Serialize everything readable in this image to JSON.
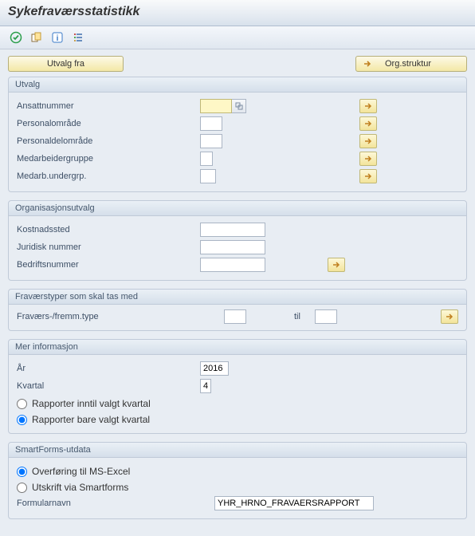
{
  "title": "Sykefraværsstatistikk",
  "icons": {
    "execute": "execute-icon",
    "variants": "variants-icon",
    "info": "info-icon",
    "list": "list-icon",
    "arrow": "arrow-icon"
  },
  "buttons": {
    "utvalg_fra": "Utvalg fra",
    "org_struktur": "Org.struktur"
  },
  "groups": {
    "utvalg": {
      "title": "Utvalg",
      "fields": {
        "ansattnummer": {
          "label": "Ansattnummer",
          "value": ""
        },
        "personalomrade": {
          "label": "Personalområde",
          "value": ""
        },
        "personaldelomrade": {
          "label": "Personaldelområde",
          "value": ""
        },
        "medarbeidergruppe": {
          "label": "Medarbeidergruppe",
          "value": ""
        },
        "medarb_undergrp": {
          "label": "Medarb.undergrp.",
          "value": ""
        }
      }
    },
    "orgutvalg": {
      "title": "Organisasjonsutvalg",
      "fields": {
        "kostnadssted": {
          "label": "Kostnadssted",
          "value": ""
        },
        "juridisk_nummer": {
          "label": "Juridisk nummer",
          "value": ""
        },
        "bedriftsnummer": {
          "label": "Bedriftsnummer",
          "value": ""
        }
      }
    },
    "fravtyper": {
      "title": "Fraværstyper som skal tas med",
      "label": "Fraværs-/fremm.type",
      "from": "",
      "til_label": "til",
      "to": ""
    },
    "merinfo": {
      "title": "Mer informasjon",
      "aar": {
        "label": "År",
        "value": "2016"
      },
      "kvartal": {
        "label": "Kvartal",
        "value": "4"
      },
      "radio_inntil": "Rapporter inntil valgt kvartal",
      "radio_bare": "Rapporter bare valgt kvartal"
    },
    "smartforms": {
      "title": "SmartForms-utdata",
      "radio_excel": "Overføring til MS-Excel",
      "radio_smart": "Utskrift via Smartforms",
      "formularnavn": {
        "label": "Formularnavn",
        "value": "YHR_HRNO_FRAVAERSRAPPORT"
      }
    }
  }
}
